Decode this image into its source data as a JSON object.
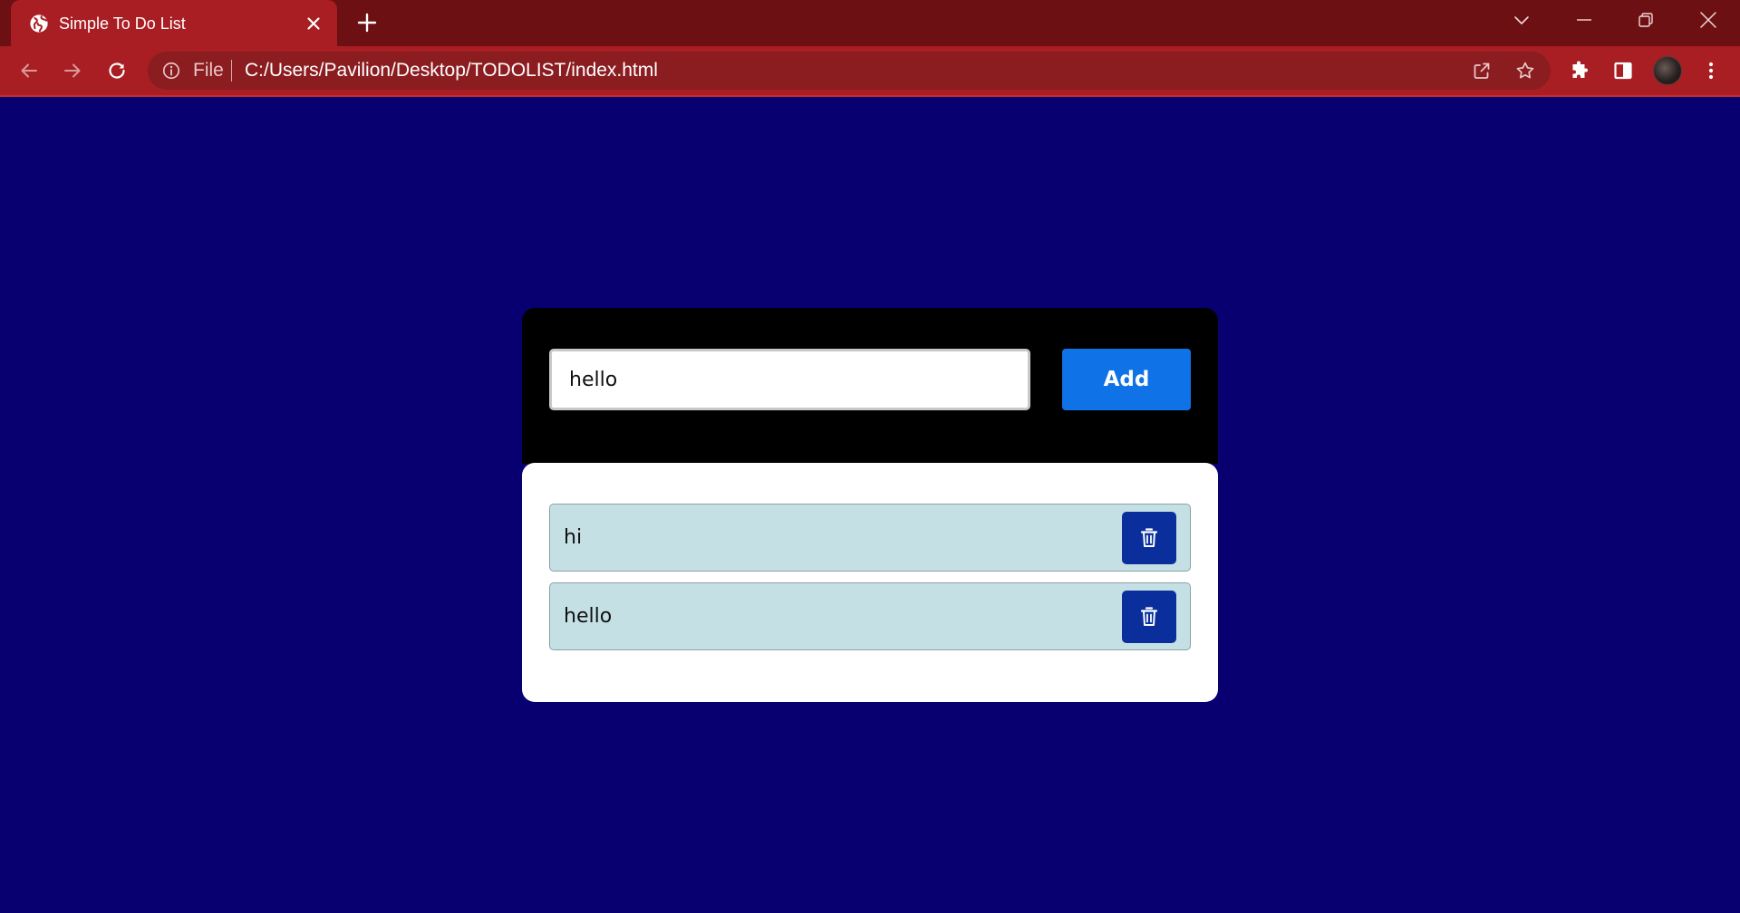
{
  "browser": {
    "tab": {
      "title": "Simple To Do List",
      "favicon": "globe-icon"
    },
    "address_bar": {
      "scheme_label": "File",
      "url": "C:/Users/Pavilion/Desktop/TODOLIST/index.html"
    },
    "icons": {
      "back": "back-arrow-icon",
      "forward": "forward-arrow-icon",
      "reload": "reload-icon",
      "info": "info-icon",
      "share": "share-icon",
      "bookmark": "star-icon",
      "extensions": "puzzle-icon",
      "side_panel": "side-panel-icon",
      "profile": "avatar",
      "menu": "kebab-menu-icon",
      "tab_search": "chevron-down-icon",
      "minimize": "minimize-icon",
      "restore": "restore-icon",
      "close_window": "close-icon"
    },
    "colors": {
      "titlebar": "#6d1013",
      "toolbar": "#a91e22",
      "omnibox": "#8b1c20"
    }
  },
  "todo": {
    "input_value": "hello",
    "add_label": "Add",
    "items": [
      {
        "text": "hi"
      },
      {
        "text": "hello"
      }
    ],
    "delete_icon": "trash-icon",
    "colors": {
      "page_background": "#080070",
      "header_background": "#000000",
      "add_button": "#0f72e6",
      "item_background": "#c5e0e4",
      "delete_button": "#0a2f9c"
    }
  }
}
